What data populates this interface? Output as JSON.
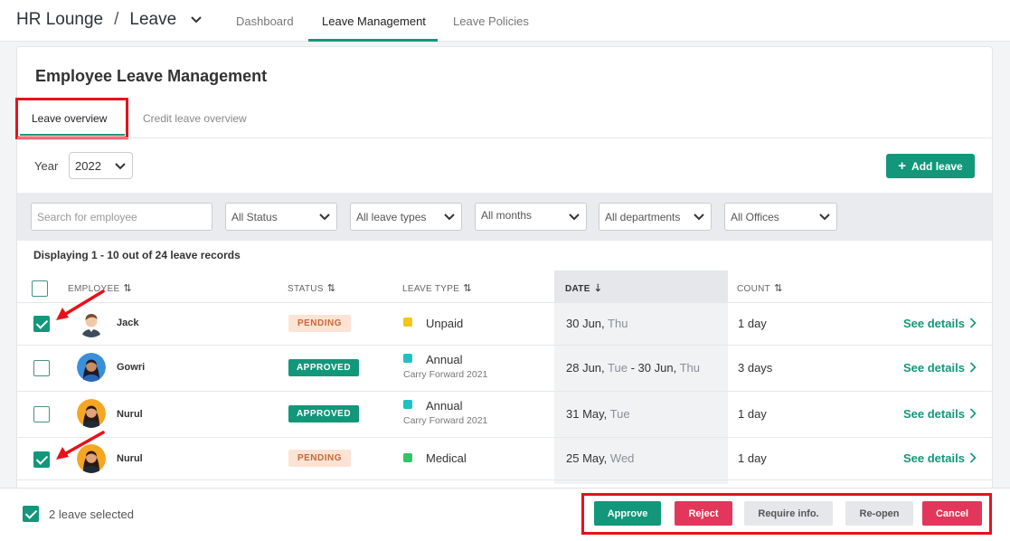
{
  "header": {
    "app_name": "HR Lounge",
    "separator": "/",
    "module": "Leave",
    "tabs": [
      {
        "label": "Dashboard",
        "active": false
      },
      {
        "label": "Leave Management",
        "active": true
      },
      {
        "label": "Leave Policies",
        "active": false
      }
    ]
  },
  "page": {
    "title": "Employee Leave Management",
    "subtabs": [
      {
        "label": "Leave overview",
        "active": true
      },
      {
        "label": "Credit leave overview",
        "active": false
      }
    ]
  },
  "controls": {
    "year_label": "Year",
    "year_value": "2022",
    "add_leave_label": "Add leave",
    "search_placeholder": "Search for employee",
    "filters": [
      "All Status",
      "All leave types",
      "All months",
      "All departments",
      "All Offices"
    ]
  },
  "table": {
    "display_text": "Displaying 1 - 10 out of 24 leave records",
    "headers": {
      "employee": "EMPLOYEE",
      "status": "STATUS",
      "leave_type": "LEAVE TYPE",
      "date": "DATE",
      "count": "COUNT"
    },
    "rows": [
      {
        "name": "Jack",
        "status": "PENDING",
        "leave_type": "Unpaid",
        "leave_sub": "",
        "date_main": "30 Jun,",
        "date_dow": "Thu",
        "date_main2": "",
        "date_dow2": "",
        "count": "1 day",
        "action": "See details",
        "checked": true,
        "dot_color": "#f5c518"
      },
      {
        "name": "Gowri",
        "status": "APPROVED",
        "leave_type": "Annual",
        "leave_sub": "Carry Forward 2021",
        "date_main": "28 Jun,",
        "date_dow": "Tue",
        "date_main2": "- 30 Jun,",
        "date_dow2": "Thu",
        "count": "3 days",
        "action": "See details",
        "checked": false,
        "dot_color": "#1fc1c1"
      },
      {
        "name": "Nurul",
        "status": "APPROVED",
        "leave_type": "Annual",
        "leave_sub": "Carry Forward 2021",
        "date_main": "31 May,",
        "date_dow": "Tue",
        "date_main2": "",
        "date_dow2": "",
        "count": "1 day",
        "action": "See details",
        "checked": false,
        "dot_color": "#1fc1c1"
      },
      {
        "name": "Nurul",
        "status": "PENDING",
        "leave_type": "Medical",
        "leave_sub": "",
        "date_main": "25 May,",
        "date_dow": "Wed",
        "date_main2": "",
        "date_dow2": "",
        "count": "1 day",
        "action": "See details",
        "checked": true,
        "dot_color": "#34c26a"
      }
    ]
  },
  "footer": {
    "selected_text": "2 leave selected",
    "buttons": {
      "approve": "Approve",
      "reject": "Reject",
      "require": "Require info.",
      "reopen": "Re-open",
      "cancel": "Cancel"
    }
  },
  "colors": {
    "accent": "#12977a",
    "danger": "#e2375a",
    "highlight": "#e8101b"
  }
}
